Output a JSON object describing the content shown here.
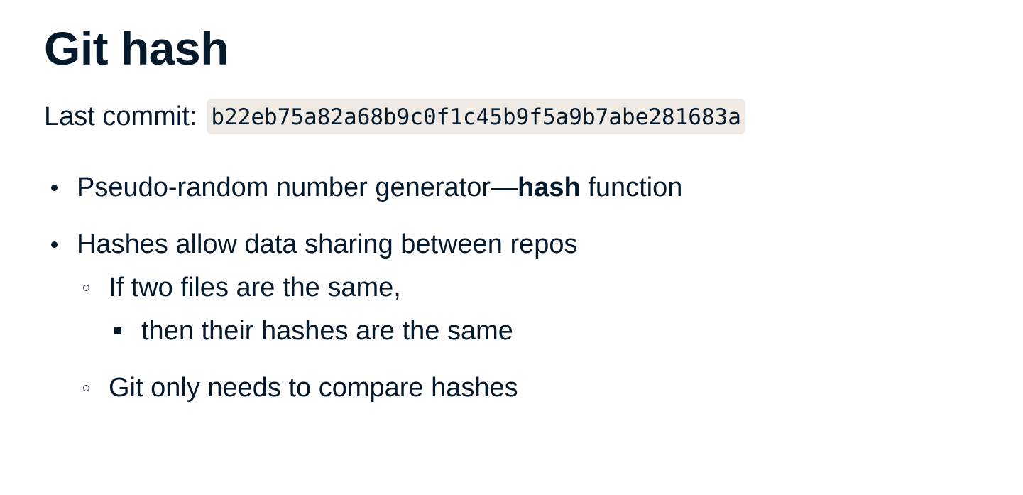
{
  "slide": {
    "title": "Git hash",
    "commit": {
      "label": "Last commit:",
      "hash": "b22eb75a82a68b9c0f1c45b9f5a9b7abe281683a"
    },
    "bullets": {
      "b1_before": "Pseudo-random number generator—",
      "b1_bold": "hash",
      "b1_after": " function",
      "b2": "Hashes allow data sharing between repos",
      "b2_sub1": "If two files are the same,",
      "b2_sub1_sub1": "then their hashes are the same",
      "b2_sub2": "Git only needs to compare hashes"
    }
  }
}
